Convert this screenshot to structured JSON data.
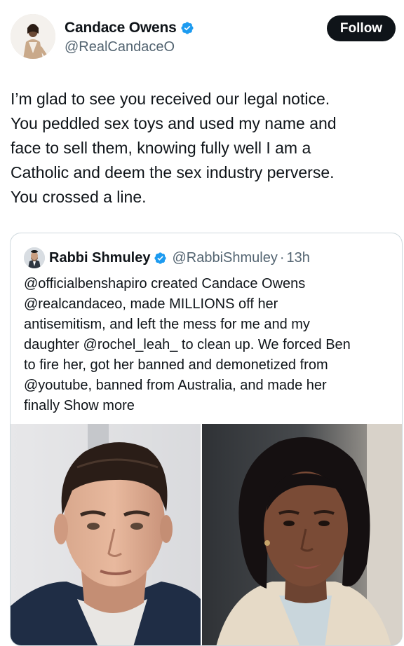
{
  "tweet": {
    "author": {
      "display_name": "Candace Owens",
      "handle": "@RealCandaceO",
      "verified_icon": "verified-badge-icon",
      "verified_color": "#1d9bf0"
    },
    "follow_label": "Follow",
    "text_lines": [
      "I’m glad to see you received our legal notice.",
      "You peddled sex toys and used my name and",
      "face to sell them, knowing fully well I am a",
      "Catholic and deem the sex industry perverse.",
      "You crossed a line."
    ]
  },
  "quote": {
    "author": {
      "display_name": "Rabbi Shmuley",
      "handle": "@RabbiShmuley",
      "separator": "·",
      "time": "13h"
    },
    "text_lines": [
      "@officialbenshapiro created Candace Owens",
      "@realcandaceo, made MILLIONS off her",
      "antisemitism, and left the mess for me and my",
      "daughter @rochel_leah_ to clean up. We forced Ben",
      "to fire her, got her banned and demonetized from",
      "@youtube, banned from Australia, and made her"
    ],
    "last_line_prefix": "finally ",
    "show_more_label": "Show more",
    "images": [
      "man-portrait-photo",
      "woman-portrait-photo"
    ]
  },
  "colors": {
    "text_primary": "#0f1419",
    "text_secondary": "#536471",
    "border": "#cfd9de",
    "follow_bg": "#0f1419",
    "verified": "#1d9bf0"
  }
}
